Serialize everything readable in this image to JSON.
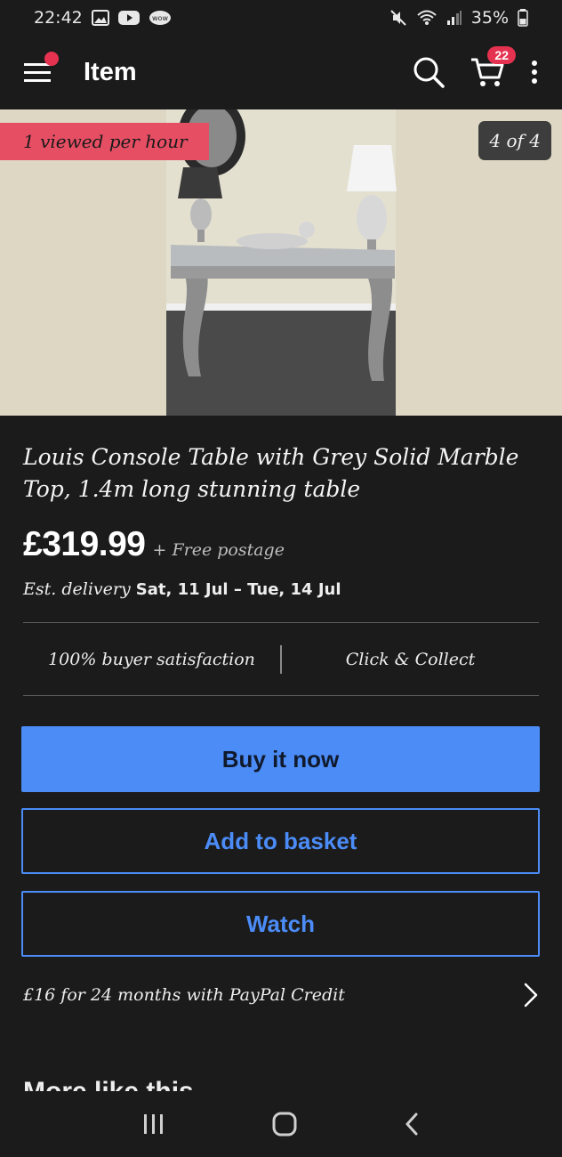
{
  "status": {
    "time": "22:42",
    "battery": "35%",
    "notif_icons": [
      "gallery-icon",
      "youtube-icon",
      "wow-icon"
    ],
    "wow_label": "wow"
  },
  "appbar": {
    "title": "Item",
    "cart_count": "22"
  },
  "hero": {
    "viewed_badge": "1 viewed per hour",
    "image_counter": "4 of 4"
  },
  "listing": {
    "title": "Louis Console Table with Grey Solid Marble Top, 1.4m long stunning table",
    "price": "£319.99",
    "postage": "+ Free postage",
    "delivery_prefix": "Est. delivery",
    "delivery_dates": "Sat, 11 Jul – Tue, 14 Jul"
  },
  "features": {
    "satisfaction": "100% buyer satisfaction",
    "collect": "Click & Collect"
  },
  "actions": {
    "buy_now": "Buy it now",
    "add_to_basket": "Add to basket",
    "watch": "Watch"
  },
  "credit": {
    "text": "£16 for 24 months with PayPal Credit"
  },
  "more": {
    "heading": "More like this"
  },
  "colors": {
    "background": "#1b1b1b",
    "accent_blue": "#4b8cf7",
    "badge_red": "#e53250"
  }
}
